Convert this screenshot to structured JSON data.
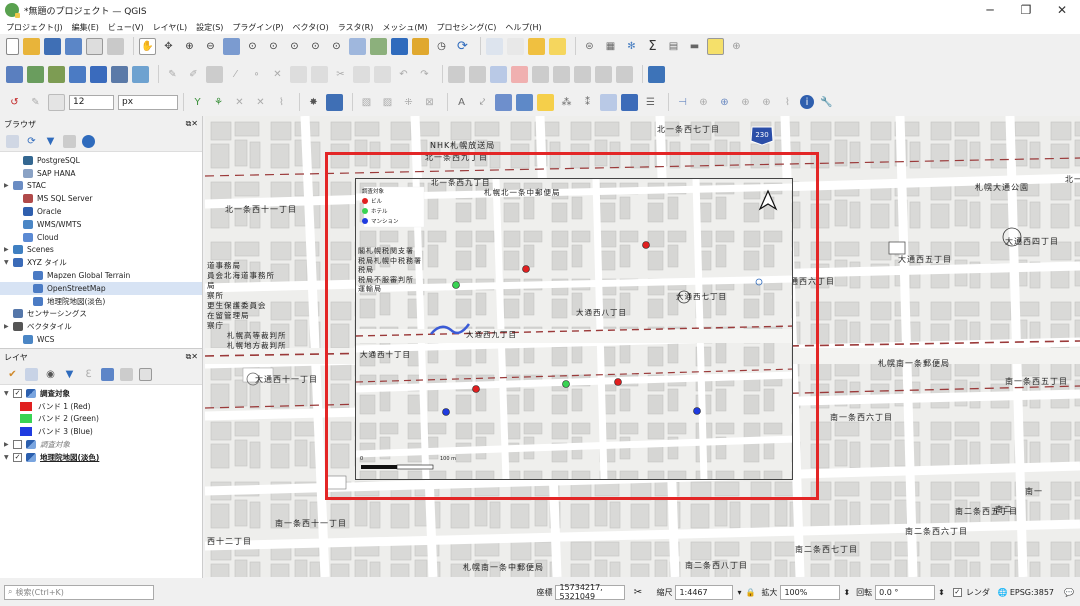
{
  "window": {
    "title": "*無題のプロジェクト — QGIS",
    "min_label": "─",
    "max_label": "❐",
    "close_label": "✕"
  },
  "menu": [
    "プロジェクト(J)",
    "編集(E)",
    "ビュー(V)",
    "レイヤ(L)",
    "設定(S)",
    "プラグイン(P)",
    "ベクタ(O)",
    "ラスタ(R)",
    "メッシュ(M)",
    "プロセシング(C)",
    "ヘルプ(H)"
  ],
  "digitize_toolbar": {
    "font_size": "12",
    "unit": "px"
  },
  "browser_panel": {
    "title": "ブラウザ",
    "items": [
      {
        "label": "PostgreSQL",
        "icon": "postgresql-icon",
        "indent": 1,
        "arrow": ""
      },
      {
        "label": "SAP HANA",
        "icon": "sap-hana-icon",
        "indent": 1,
        "arrow": ""
      },
      {
        "label": "STAC",
        "icon": "stac-icon",
        "indent": 0,
        "arrow": "▶"
      },
      {
        "label": "MS SQL Server",
        "icon": "mssql-icon",
        "indent": 1,
        "arrow": ""
      },
      {
        "label": "Oracle",
        "icon": "oracle-icon",
        "indent": 1,
        "arrow": ""
      },
      {
        "label": "WMS/WMTS",
        "icon": "wms-icon",
        "indent": 1,
        "arrow": ""
      },
      {
        "label": "Cloud",
        "icon": "cloud-icon",
        "indent": 1,
        "arrow": ""
      },
      {
        "label": "Scenes",
        "icon": "scenes-icon",
        "indent": 0,
        "arrow": "▶"
      },
      {
        "label": "XYZ タイル",
        "icon": "xyz-tiles-icon",
        "indent": 0,
        "arrow": "▼"
      },
      {
        "label": "Mapzen Global Terrain",
        "icon": "tile-icon",
        "indent": 2,
        "arrow": ""
      },
      {
        "label": "OpenStreetMap",
        "icon": "tile-icon",
        "indent": 2,
        "arrow": "",
        "selected": true
      },
      {
        "label": "地理院地図(淡色)",
        "icon": "tile-icon",
        "indent": 2,
        "arrow": ""
      },
      {
        "label": "センサーシングス",
        "icon": "sensorthings-icon",
        "indent": 0,
        "arrow": ""
      },
      {
        "label": "ベクタタイル",
        "icon": "vector-tile-icon",
        "indent": 0,
        "arrow": "▶"
      },
      {
        "label": "WCS",
        "icon": "wcs-icon",
        "indent": 1,
        "arrow": ""
      }
    ]
  },
  "layers_panel": {
    "title": "レイヤ",
    "items": [
      {
        "label": "調査対象",
        "bold": true,
        "checked": true,
        "arrow": "▼",
        "indent": 0
      },
      {
        "label": "バンド 1 (Red)",
        "swatch": "#e02020",
        "indent": 2
      },
      {
        "label": "バンド 2 (Green)",
        "swatch": "#39d353",
        "indent": 2
      },
      {
        "label": "バンド 3 (Blue)",
        "swatch": "#1f3be0",
        "indent": 2
      },
      {
        "label": "調査対象",
        "italic": true,
        "checked": false,
        "arrow": "▶",
        "indent": 0
      },
      {
        "label": "地理院地図(淡色)",
        "bold": true,
        "underline": true,
        "checked": true,
        "arrow": "▼",
        "indent": 0
      }
    ]
  },
  "map": {
    "labels": [
      {
        "text": "NHK札幌放送局"
      },
      {
        "text": "北一条西九丁目"
      },
      {
        "text": "北一条西七丁目"
      },
      {
        "text": "北一条西十一丁目"
      },
      {
        "text": "札幌北一条中郵便局"
      },
      {
        "text": "札幌大通公園"
      },
      {
        "text": "大通西四丁目"
      },
      {
        "text": "大通西五丁目"
      },
      {
        "text": "通西六丁目"
      },
      {
        "text": "大通西七丁目"
      },
      {
        "text": "大通西八丁目"
      },
      {
        "text": "大通西九丁目"
      },
      {
        "text": "大通西十丁目"
      },
      {
        "text": "大通西十一丁目"
      },
      {
        "text": "札幌南一条郵便局"
      },
      {
        "text": "南一条西五丁目"
      },
      {
        "text": "南一条西六丁目"
      },
      {
        "text": "南一条西七丁目"
      },
      {
        "text": "南一条西八丁目"
      },
      {
        "text": "南一条西十一丁目"
      },
      {
        "text": "南二条西五丁目"
      },
      {
        "text": "南二条西六丁目"
      },
      {
        "text": "南二条西七丁目"
      },
      {
        "text": "南二条西八丁目"
      },
      {
        "text": "札幌南一条中郵便局"
      },
      {
        "text": "西十二丁目"
      },
      {
        "text": "南一"
      },
      {
        "text": "南二"
      },
      {
        "text": "北一"
      }
    ],
    "route_shield": "230",
    "vertical_labels": [
      "道事務局",
      "員会北海道事務所",
      "局",
      "察所",
      "更生保護委員会",
      "在留管理局",
      "察庁"
    ],
    "left_col_labels": [
      "札幌高等裁判所",
      "札幌地方裁判所"
    ]
  },
  "inset": {
    "legend_title": "調査対象",
    "legend": [
      {
        "label": "ビル",
        "color": "#e02020"
      },
      {
        "label": "ホテル",
        "color": "#39d353"
      },
      {
        "label": "マンション",
        "color": "#1f3be0"
      }
    ],
    "scale_labels": [
      "0",
      "100 m"
    ],
    "side_labels": [
      "閣札幌税関支署",
      "税局札幌中税務署",
      "税局",
      "税局不服審判所",
      "運輸局"
    ],
    "points_note": ""
  },
  "status": {
    "search_placeholder": "検索(Ctrl+K)",
    "coord_label": "座標",
    "coord_value": "15734217, 5321049",
    "scale_label": "縮尺",
    "scale_value": "1:4467",
    "zoom_label": "拡大",
    "zoom_value": "100%",
    "rotation_label": "回転",
    "rotation_value": "0.0 °",
    "render_label": "レンダ",
    "crs": "EPSG:3857"
  },
  "colors": {
    "highlight": "#e32626",
    "road_dash": "#9b3a3a"
  }
}
